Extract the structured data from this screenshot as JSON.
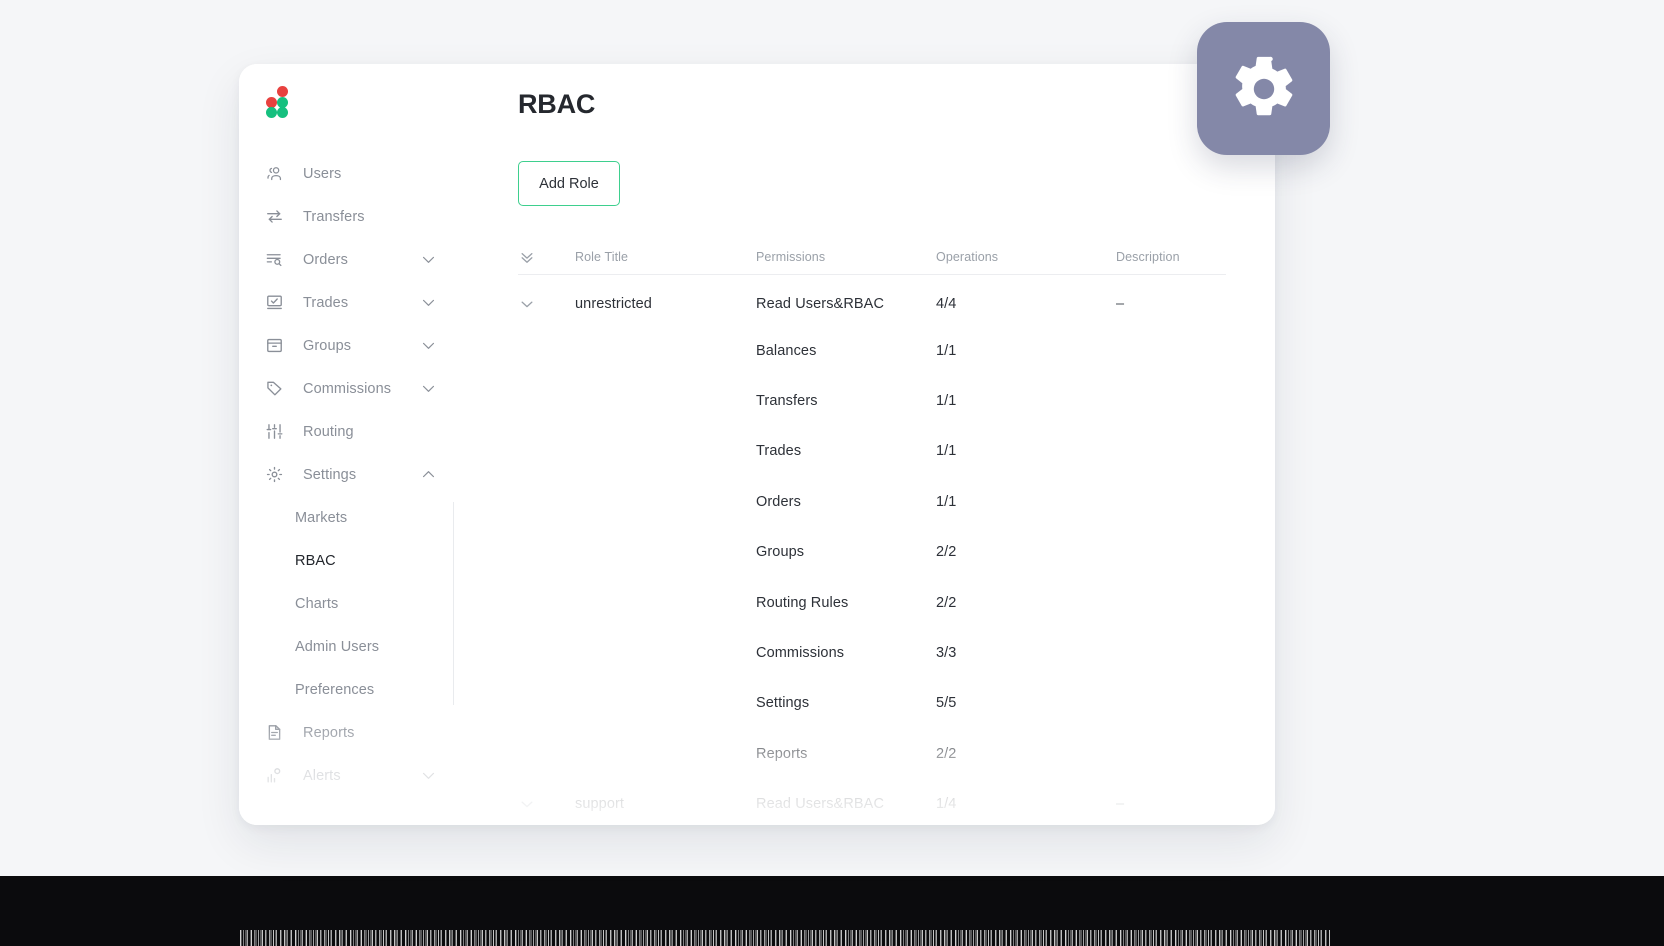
{
  "header": {
    "title": "RBAC"
  },
  "logo": {
    "name": "app-logo",
    "dot_colors": [
      "#e8413f",
      "#e8413f",
      "#16c07f",
      "#16c07f",
      "#16c07f"
    ]
  },
  "toolbar": {
    "add_role_label": "Add Role",
    "add_role_border_color": "#3ecf8e"
  },
  "sidebar": {
    "items": [
      {
        "label": "Users",
        "icon": "users-icon",
        "chevron": false,
        "active": false
      },
      {
        "label": "Transfers",
        "icon": "transfers-icon",
        "chevron": false,
        "active": false
      },
      {
        "label": "Orders",
        "icon": "orders-icon",
        "chevron": "down",
        "active": false
      },
      {
        "label": "Trades",
        "icon": "trades-icon",
        "chevron": "down",
        "active": false
      },
      {
        "label": "Groups",
        "icon": "groups-icon",
        "chevron": "down",
        "active": false
      },
      {
        "label": "Commissions",
        "icon": "commissions-icon",
        "chevron": "down",
        "active": false
      },
      {
        "label": "Routing",
        "icon": "routing-icon",
        "chevron": false,
        "active": false
      },
      {
        "label": "Settings",
        "icon": "settings-gear-icon",
        "chevron": "up",
        "active": false
      }
    ],
    "settings_submenu": [
      {
        "label": "Markets",
        "active": false
      },
      {
        "label": "RBAC",
        "active": true
      },
      {
        "label": "Charts",
        "active": false
      },
      {
        "label": "Admin Users",
        "active": false
      },
      {
        "label": "Preferences",
        "active": false
      }
    ],
    "items_after": [
      {
        "label": "Reports",
        "icon": "reports-icon",
        "chevron": false,
        "active": false
      },
      {
        "label": "Alerts",
        "icon": "alerts-icon",
        "chevron": "down",
        "active": false
      }
    ]
  },
  "table": {
    "columns": [
      "Role Title",
      "Permissions",
      "Operations",
      "Description"
    ],
    "expand_all_icon": "double-chevron-down-icon",
    "rows": [
      {
        "role": "unrestricted",
        "description": "–",
        "expanded": true,
        "permissions": [
          {
            "permission": "Read Users&RBAC",
            "operations": "4/4"
          },
          {
            "permission": "Balances",
            "operations": "1/1"
          },
          {
            "permission": "Transfers",
            "operations": "1/1"
          },
          {
            "permission": "Trades",
            "operations": "1/1"
          },
          {
            "permission": "Orders",
            "operations": "1/1"
          },
          {
            "permission": "Groups",
            "operations": "2/2"
          },
          {
            "permission": "Routing Rules",
            "operations": "2/2"
          },
          {
            "permission": "Commissions",
            "operations": "3/3"
          },
          {
            "permission": "Settings",
            "operations": "5/5"
          },
          {
            "permission": "Reports",
            "operations": "2/2"
          }
        ]
      },
      {
        "role": "support",
        "description": "–",
        "expanded": true,
        "permissions": [
          {
            "permission": "Read Users&RBAC",
            "operations": "1/4"
          }
        ]
      }
    ]
  },
  "gear_badge": {
    "icon": "settings-gear-icon",
    "background_color": "#8488a8"
  }
}
